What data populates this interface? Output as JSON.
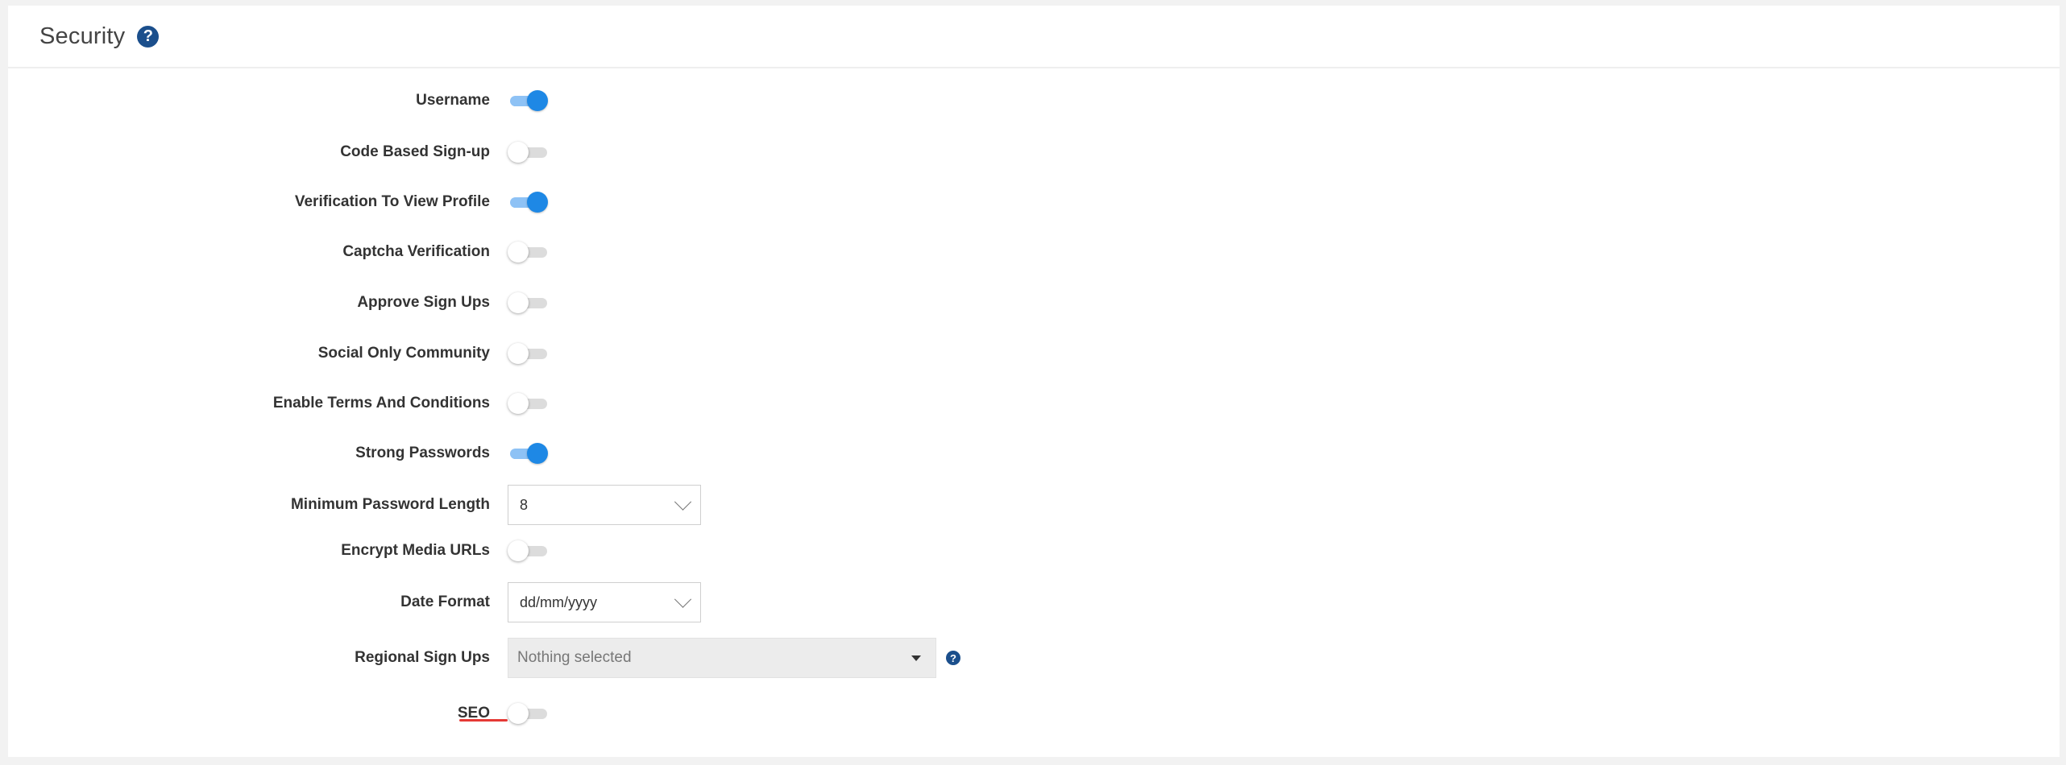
{
  "section": {
    "title": "Security",
    "help_glyph": "?"
  },
  "settings": [
    {
      "label": "Username",
      "type": "toggle",
      "enabled": true
    },
    {
      "label": "Code Based Sign-up",
      "type": "toggle",
      "enabled": false
    },
    {
      "label": "Verification To View Profile",
      "type": "toggle",
      "enabled": true
    },
    {
      "label": "Captcha Verification",
      "type": "toggle",
      "enabled": false
    },
    {
      "label": "Approve Sign Ups",
      "type": "toggle",
      "enabled": false
    },
    {
      "label": "Social Only Community",
      "type": "toggle",
      "enabled": false
    },
    {
      "label": "Enable Terms And Conditions",
      "type": "toggle",
      "enabled": false
    },
    {
      "label": "Strong Passwords",
      "type": "toggle",
      "enabled": true
    },
    {
      "label": "Minimum Password Length",
      "type": "select",
      "value": "8"
    },
    {
      "label": "Encrypt Media URLs",
      "type": "toggle",
      "enabled": false
    },
    {
      "label": "Date Format",
      "type": "select",
      "value": "dd/mm/yyyy"
    },
    {
      "label": "Regional Sign Ups",
      "type": "multiselect",
      "placeholder": "Nothing selected",
      "help_glyph": "?"
    },
    {
      "label": "SEO",
      "type": "toggle",
      "enabled": false
    }
  ],
  "colors": {
    "toggle_on_knob": "#1e88e5",
    "toggle_on_track": "#8ec2f5",
    "help_icon": "#1b4f8c",
    "seo_highlight": "#e53935"
  }
}
